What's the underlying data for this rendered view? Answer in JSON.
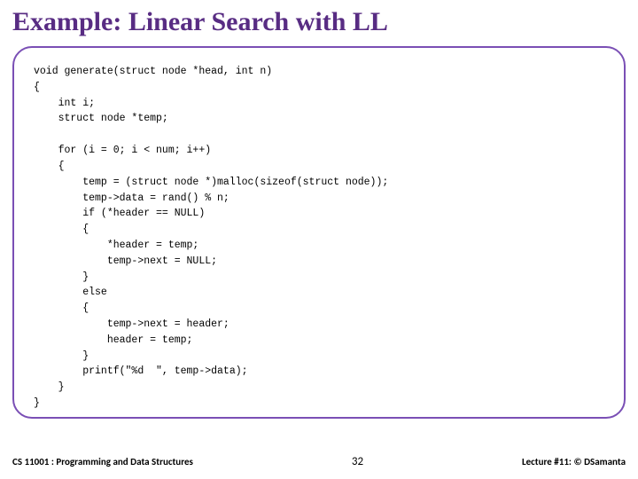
{
  "title": "Example: Linear Search with LL",
  "code": "void generate(struct node *head, int n)\n{\n    int i;\n    struct node *temp;\n\n    for (i = 0; i < num; i++)\n    {\n        temp = (struct node *)malloc(sizeof(struct node));\n        temp->data = rand() % n;\n        if (*header == NULL)\n        {\n            *header = temp;\n            temp->next = NULL;\n        }\n        else\n        {\n            temp->next = header;\n            header = temp;\n        }\n        printf(\"%d  \", temp->data);\n    }\n}",
  "footer": {
    "left": "CS 11001 : Programming and Data Structures",
    "page": "32",
    "right": "Lecture #11: © DSamanta"
  }
}
